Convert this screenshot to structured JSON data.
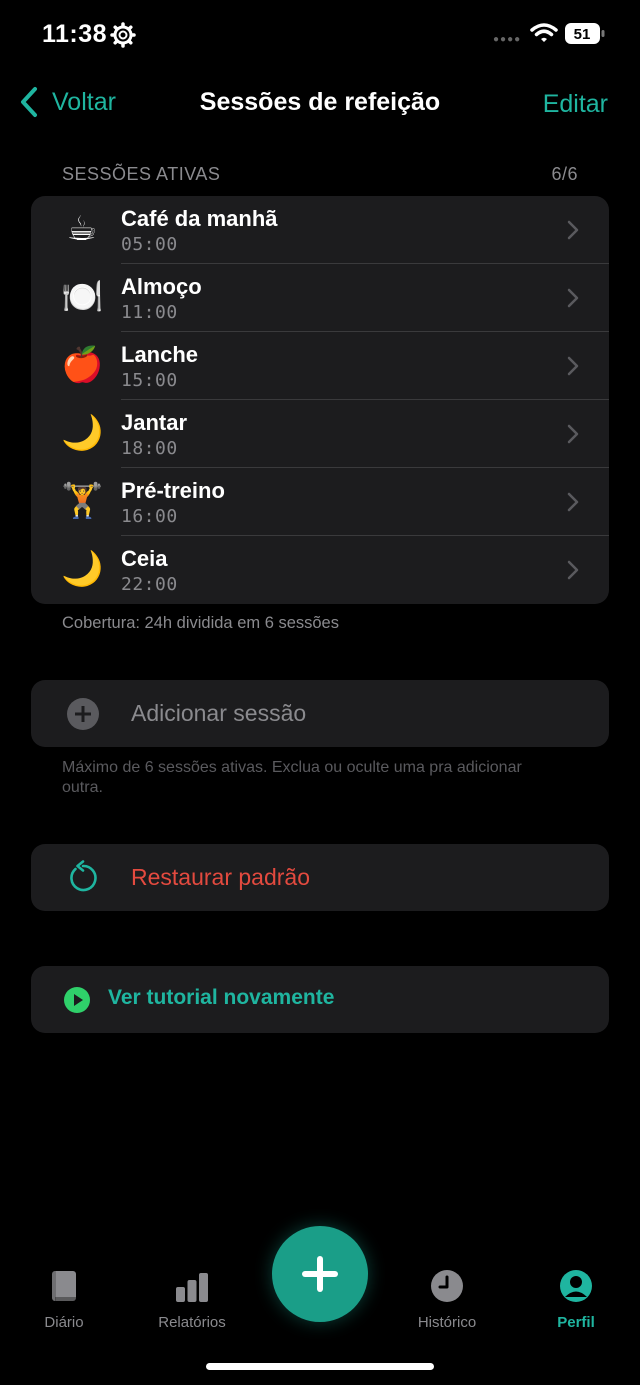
{
  "status_bar": {
    "time": "11:38",
    "battery": "51"
  },
  "nav": {
    "back_label": "Voltar",
    "title": "Sessões de refeição",
    "edit_label": "Editar"
  },
  "sessions_section": {
    "header": "SESSÕES ATIVAS",
    "count": "6/6",
    "items": [
      {
        "emoji": "☕",
        "name": "Café da manhã",
        "time": "05:00"
      },
      {
        "emoji": "🍽️",
        "name": "Almoço",
        "time": "11:00"
      },
      {
        "emoji": "🍎",
        "name": "Lanche",
        "time": "15:00"
      },
      {
        "emoji": "🌙",
        "name": "Jantar",
        "time": "18:00"
      },
      {
        "emoji": "🏋️",
        "name": "Pré-treino",
        "time": "16:00"
      },
      {
        "emoji": "🌙",
        "name": "Ceia",
        "time": "22:00"
      }
    ],
    "footer": "Cobertura: 24h dividida em 6 sessões"
  },
  "add_session": {
    "label": "Adicionar sessão",
    "note": "Máximo de 6 sessões ativas. Exclua ou oculte uma pra adicionar outra."
  },
  "restore": {
    "label": "Restaurar padrão"
  },
  "tutorial": {
    "label": "Ver tutorial novamente"
  },
  "tabbar": {
    "tabs": [
      {
        "label": "Diário",
        "icon": "book-icon"
      },
      {
        "label": "Relatórios",
        "icon": "bar-chart-icon"
      },
      {
        "label": "Histórico",
        "icon": "clock-icon"
      },
      {
        "label": "Perfil",
        "icon": "person-icon"
      }
    ],
    "active": "Perfil"
  },
  "colors": {
    "accent": "#1fb5a0",
    "danger": "#e34a3f",
    "play": "#2fd06a",
    "card": "#1c1c1e"
  }
}
